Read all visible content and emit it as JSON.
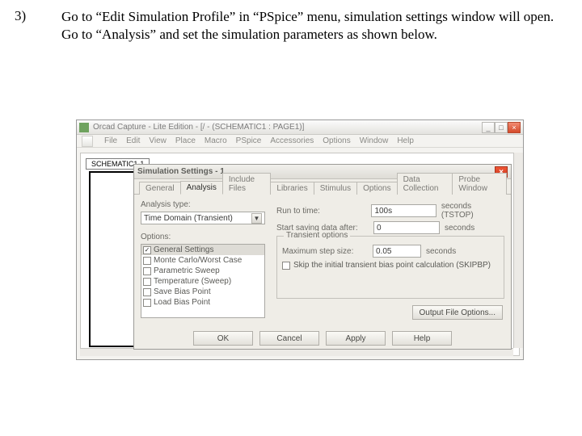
{
  "step": {
    "number": "3)",
    "text": "Go to “Edit Simulation Profile” in “PSpice” menu, simulation settings window will open. Go to “Analysis” and set the simulation parameters as shown below."
  },
  "app": {
    "title": "Orcad Capture - Lite Edition - [/ - (SCHEMATIC1 : PAGE1)]",
    "menu": [
      "File",
      "Edit",
      "View",
      "Place",
      "Macro",
      "PSpice",
      "Accessories",
      "Options",
      "Window",
      "Help"
    ],
    "schematic_tab": "SCHEMATIC1-1"
  },
  "dialog": {
    "title": "Simulation Settings - 1",
    "tabs": [
      "General",
      "Analysis",
      "Include Files",
      "Libraries",
      "Stimulus",
      "Options",
      "Data Collection",
      "Probe Window"
    ],
    "active_tab_index": 1,
    "analysis_type_label": "Analysis type:",
    "analysis_type_value": "Time Domain (Transient)",
    "options_label": "Options:",
    "options_list": [
      {
        "label": "General Settings",
        "checked": true,
        "selected": true
      },
      {
        "label": "Monte Carlo/Worst Case",
        "checked": false,
        "selected": false
      },
      {
        "label": "Parametric Sweep",
        "checked": false,
        "selected": false
      },
      {
        "label": "Temperature (Sweep)",
        "checked": false,
        "selected": false
      },
      {
        "label": "Save Bias Point",
        "checked": false,
        "selected": false
      },
      {
        "label": "Load Bias Point",
        "checked": false,
        "selected": false
      }
    ],
    "run_to_label": "Run to time:",
    "run_to_value": "100s",
    "run_to_unit": "seconds (TSTOP)",
    "start_label": "Start saving data after:",
    "start_value": "0",
    "start_unit": "seconds",
    "transient_legend": "Transient options",
    "max_step_label": "Maximum step size:",
    "max_step_value": "0.05",
    "max_step_unit": "seconds",
    "skip_label": "Skip the initial transient bias point calculation (SKIPBP)",
    "out_file_btn": "Output File Options...",
    "buttons": {
      "ok": "OK",
      "cancel": "Cancel",
      "apply": "Apply",
      "help": "Help"
    }
  }
}
